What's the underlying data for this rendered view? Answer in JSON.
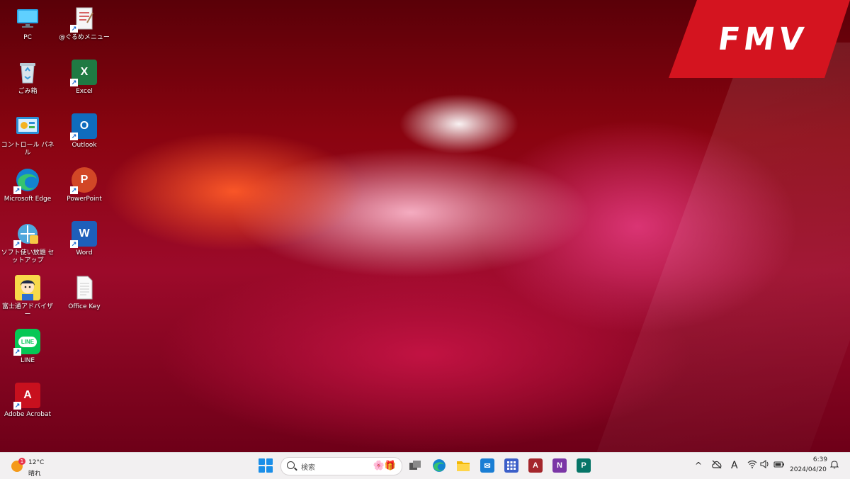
{
  "desktop": {
    "brand": "FMV",
    "icons": [
      {
        "label": "PC",
        "icon": "monitor-icon"
      },
      {
        "label": "ごみ箱",
        "icon": "recycle-bin-icon"
      },
      {
        "label": "コントロール パネル",
        "icon": "control-panel-icon"
      },
      {
        "label": "Microsoft Edge",
        "icon": "edge-icon"
      },
      {
        "label": "ソフト使い放題 セットアップ",
        "icon": "software-setup-icon"
      },
      {
        "label": "富士通アドバイザー",
        "icon": "advisor-icon"
      },
      {
        "label": "LINE",
        "icon": "line-icon"
      },
      {
        "label": "Adobe Acrobat",
        "icon": "acrobat-icon"
      },
      {
        "label": "@ぐるめメニュー",
        "icon": "menu-doc-icon"
      },
      {
        "label": "Excel",
        "icon": "excel-icon"
      },
      {
        "label": "Outlook",
        "icon": "outlook-icon"
      },
      {
        "label": "PowerPoint",
        "icon": "powerpoint-icon"
      },
      {
        "label": "Word",
        "icon": "word-icon"
      },
      {
        "label": "Office Key",
        "icon": "document-icon"
      }
    ],
    "glyphs": {
      "excel": "X",
      "outlook": "O",
      "powerpoint": "P",
      "word": "W",
      "line": "LINE",
      "acrobat": "A"
    }
  },
  "taskbar": {
    "weather": {
      "temp": "12°C",
      "condition": "晴れ",
      "badge": "1"
    },
    "search": {
      "placeholder": "検索"
    },
    "apps": [
      {
        "name": "task-view",
        "glyph": ""
      },
      {
        "name": "edge",
        "glyph": "e"
      },
      {
        "name": "file-explorer",
        "glyph": ""
      },
      {
        "name": "mail",
        "glyph": "✉"
      },
      {
        "name": "calculator",
        "glyph": ""
      },
      {
        "name": "access",
        "glyph": "A"
      },
      {
        "name": "onenote",
        "glyph": "N"
      },
      {
        "name": "publisher",
        "glyph": "P"
      }
    ],
    "tray": {
      "chevron": "^",
      "ime": "A"
    },
    "clock": {
      "time": "6:39",
      "date": "2024/04/20"
    }
  },
  "colors": {
    "brand_red": "#d4141f",
    "excel": "#1f7a43",
    "outlook": "#0f6cbd",
    "powerpoint": "#d24726",
    "word": "#1e5fba",
    "line": "#06c755",
    "acrobat": "#c8101e"
  }
}
